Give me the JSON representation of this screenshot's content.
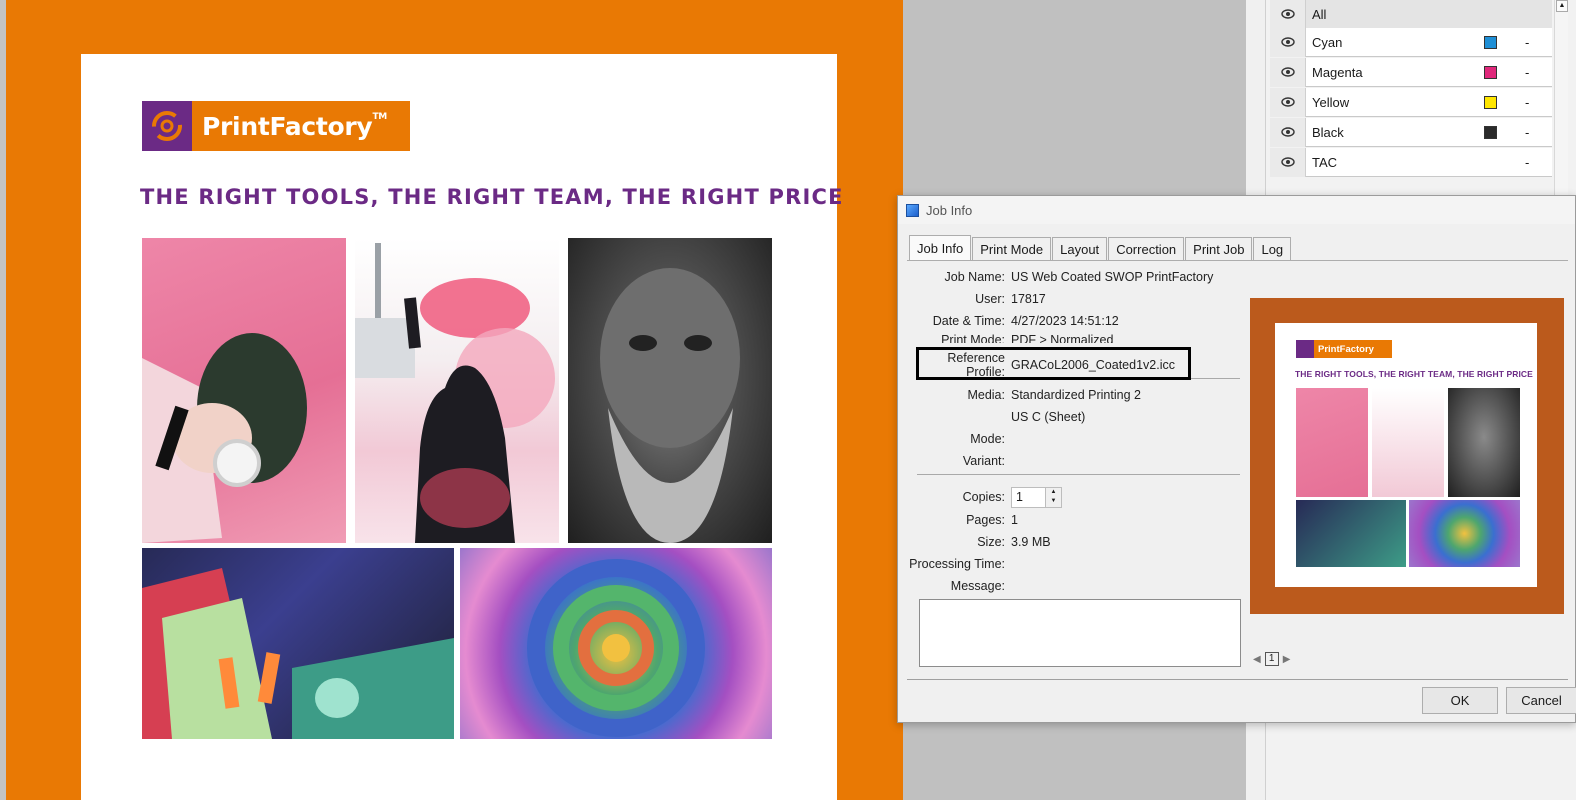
{
  "document": {
    "logo_text": "PrintFactory",
    "logo_tm": "TM",
    "tagline": "THE RIGHT TOOLS, THE RIGHT TEAM, THE RIGHT PRICE",
    "colors": {
      "artboard": "#e97904",
      "brand_purple": "#6b2a85"
    }
  },
  "separations": {
    "rows": [
      {
        "label": "All",
        "value": "",
        "swatch": ""
      },
      {
        "label": "Cyan",
        "value": "-",
        "swatch": "#1e8fd6"
      },
      {
        "label": "Magenta",
        "value": "-",
        "swatch": "#e0287b"
      },
      {
        "label": "Yellow",
        "value": "-",
        "swatch": "#ffe600"
      },
      {
        "label": "Black",
        "value": "-",
        "swatch": "#2b2b2b"
      },
      {
        "label": "TAC",
        "value": "-",
        "swatch": ""
      }
    ]
  },
  "dialog": {
    "title": "Job Info",
    "tabs": [
      "Job Info",
      "Print Mode",
      "Layout",
      "Correction",
      "Print Job",
      "Log"
    ],
    "active_tab": "Job Info",
    "fields": {
      "job_name_label": "Job Name:",
      "job_name": "US Web Coated SWOP PrintFactory",
      "user_label": "User:",
      "user": "17817",
      "datetime_label": "Date & Time:",
      "datetime": "4/27/2023 14:51:12",
      "print_mode_label": "Print Mode:",
      "print_mode": "PDF > Normalized",
      "ref_profile_label": "Reference Profile:",
      "ref_profile": "GRACoL2006_Coated1v2.icc",
      "media_label": "Media:",
      "media": "Standardized Printing 2",
      "media_sub": "US C (Sheet)",
      "mode_label": "Mode:",
      "mode": "",
      "variant_label": "Variant:",
      "variant": "",
      "copies_label": "Copies:",
      "copies": "1",
      "pages_label": "Pages:",
      "pages": "1",
      "size_label": "Size:",
      "size": "3.9 MB",
      "processing_time_label": "Processing Time:",
      "processing_time": "",
      "message_label": "Message:",
      "message": ""
    },
    "preview": {
      "logo_text": "PrintFactory",
      "tagline": "THE RIGHT TOOLS, THE RIGHT TEAM, THE RIGHT PRICE",
      "page_number": "1"
    },
    "buttons": {
      "ok": "OK",
      "cancel": "Cancel"
    }
  }
}
